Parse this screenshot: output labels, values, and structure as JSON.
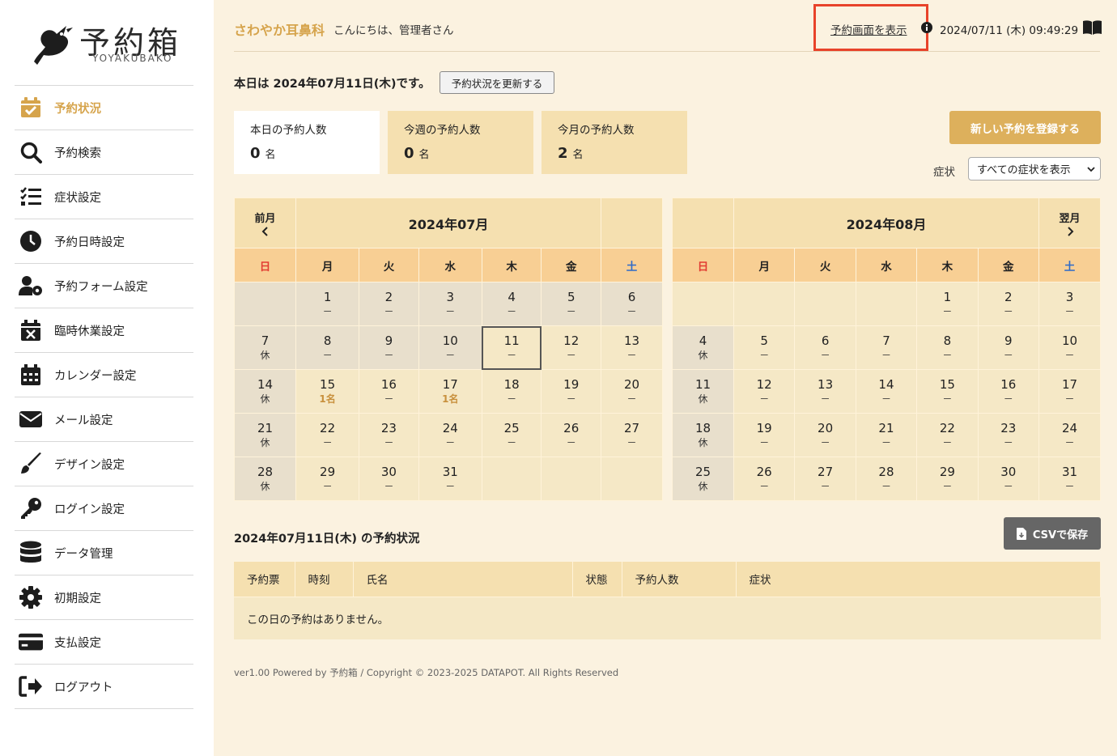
{
  "brand": {
    "title": "予約箱",
    "subtitle": "YOYAKUBAKO"
  },
  "sidebar": {
    "items": [
      {
        "label": "予約状況",
        "icon": "calendar-check-icon",
        "active": true
      },
      {
        "label": "予約検索",
        "icon": "search-icon"
      },
      {
        "label": "症状設定",
        "icon": "checklist-icon"
      },
      {
        "label": "予約日時設定",
        "icon": "clock-icon"
      },
      {
        "label": "予約フォーム設定",
        "icon": "user-gear-icon"
      },
      {
        "label": "臨時休業設定",
        "icon": "calendar-x-icon"
      },
      {
        "label": "カレンダー設定",
        "icon": "calendar-grid-icon"
      },
      {
        "label": "メール設定",
        "icon": "envelope-icon"
      },
      {
        "label": "デザイン設定",
        "icon": "paintbrush-icon"
      },
      {
        "label": "ログイン設定",
        "icon": "key-icon"
      },
      {
        "label": "データ管理",
        "icon": "database-icon"
      },
      {
        "label": "初期設定",
        "icon": "gear-icon"
      },
      {
        "label": "支払設定",
        "icon": "credit-card-icon"
      },
      {
        "label": "ログアウト",
        "icon": "logout-icon"
      }
    ]
  },
  "header": {
    "clinic": "さわやか耳鼻科",
    "greeting": "こんにちは、管理者さん",
    "view_link": "予約画面を表示",
    "datetime": "2024/07/11 (木) 09:49:29"
  },
  "today": {
    "text": "本日は 2024年07月11日(木)です。",
    "refresh_label": "予約状況を更新する"
  },
  "counts": {
    "today": {
      "label": "本日の予約人数",
      "value": "0",
      "unit": "名"
    },
    "week": {
      "label": "今週の予約人数",
      "value": "0",
      "unit": "名"
    },
    "month": {
      "label": "今月の予約人数",
      "value": "2",
      "unit": "名"
    }
  },
  "new_booking_label": "新しい予約を登録する",
  "symptom": {
    "label": "症状",
    "selected": "すべての症状を表示"
  },
  "weekdays": [
    "日",
    "月",
    "火",
    "水",
    "木",
    "金",
    "土"
  ],
  "calendars": [
    {
      "title": "2024年07月",
      "nav_label": "前月",
      "weeks": [
        [
          null,
          {
            "d": "1",
            "s": "－"
          },
          {
            "d": "2",
            "s": "－"
          },
          {
            "d": "3",
            "s": "－"
          },
          {
            "d": "4",
            "s": "－"
          },
          {
            "d": "5",
            "s": "－"
          },
          {
            "d": "6",
            "s": "－"
          }
        ],
        [
          {
            "d": "7",
            "s": "休"
          },
          {
            "d": "8",
            "s": "－"
          },
          {
            "d": "9",
            "s": "－"
          },
          {
            "d": "10",
            "s": "－"
          },
          {
            "d": "11",
            "s": "－",
            "today": true
          },
          {
            "d": "12",
            "s": "－"
          },
          {
            "d": "13",
            "s": "－"
          }
        ],
        [
          {
            "d": "14",
            "s": "休"
          },
          {
            "d": "15",
            "s": "1名",
            "has": true
          },
          {
            "d": "16",
            "s": "－"
          },
          {
            "d": "17",
            "s": "1名",
            "has": true
          },
          {
            "d": "18",
            "s": "－"
          },
          {
            "d": "19",
            "s": "－"
          },
          {
            "d": "20",
            "s": "－"
          }
        ],
        [
          {
            "d": "21",
            "s": "休"
          },
          {
            "d": "22",
            "s": "－"
          },
          {
            "d": "23",
            "s": "－"
          },
          {
            "d": "24",
            "s": "－"
          },
          {
            "d": "25",
            "s": "－"
          },
          {
            "d": "26",
            "s": "－"
          },
          {
            "d": "27",
            "s": "－"
          }
        ],
        [
          {
            "d": "28",
            "s": "休"
          },
          {
            "d": "29",
            "s": "－"
          },
          {
            "d": "30",
            "s": "－"
          },
          {
            "d": "31",
            "s": "－"
          },
          null,
          null,
          null
        ]
      ]
    },
    {
      "title": "2024年08月",
      "nav_label": "翌月",
      "weeks": [
        [
          null,
          null,
          null,
          null,
          {
            "d": "1",
            "s": "－"
          },
          {
            "d": "2",
            "s": "－"
          },
          {
            "d": "3",
            "s": "－"
          }
        ],
        [
          {
            "d": "4",
            "s": "休"
          },
          {
            "d": "5",
            "s": "－"
          },
          {
            "d": "6",
            "s": "－"
          },
          {
            "d": "7",
            "s": "－"
          },
          {
            "d": "8",
            "s": "－"
          },
          {
            "d": "9",
            "s": "－"
          },
          {
            "d": "10",
            "s": "－"
          }
        ],
        [
          {
            "d": "11",
            "s": "休"
          },
          {
            "d": "12",
            "s": "－"
          },
          {
            "d": "13",
            "s": "－"
          },
          {
            "d": "14",
            "s": "－"
          },
          {
            "d": "15",
            "s": "－"
          },
          {
            "d": "16",
            "s": "－"
          },
          {
            "d": "17",
            "s": "－"
          }
        ],
        [
          {
            "d": "18",
            "s": "休"
          },
          {
            "d": "19",
            "s": "－"
          },
          {
            "d": "20",
            "s": "－"
          },
          {
            "d": "21",
            "s": "－"
          },
          {
            "d": "22",
            "s": "－"
          },
          {
            "d": "23",
            "s": "－"
          },
          {
            "d": "24",
            "s": "－"
          }
        ],
        [
          {
            "d": "25",
            "s": "休"
          },
          {
            "d": "26",
            "s": "－"
          },
          {
            "d": "27",
            "s": "－"
          },
          {
            "d": "28",
            "s": "－"
          },
          {
            "d": "29",
            "s": "－"
          },
          {
            "d": "30",
            "s": "－"
          },
          {
            "d": "31",
            "s": "－"
          }
        ]
      ]
    }
  ],
  "reservations": {
    "title": "2024年07月11日(木) の予約状況",
    "csv_label": "CSVで保存",
    "columns": [
      "予約票",
      "時刻",
      "氏名",
      "状態",
      "予約人数",
      "症状"
    ],
    "empty_message": "この日の予約はありません。"
  },
  "footer": "ver1.00 Powered by 予約箱 / Copyright © 2023-2025 DATAPOT. All Rights Reserved",
  "colors": {
    "accent": "#d6a44c",
    "highlight": "#e8432a",
    "sunday": "#e23c32",
    "saturday": "#2f6bc8"
  }
}
